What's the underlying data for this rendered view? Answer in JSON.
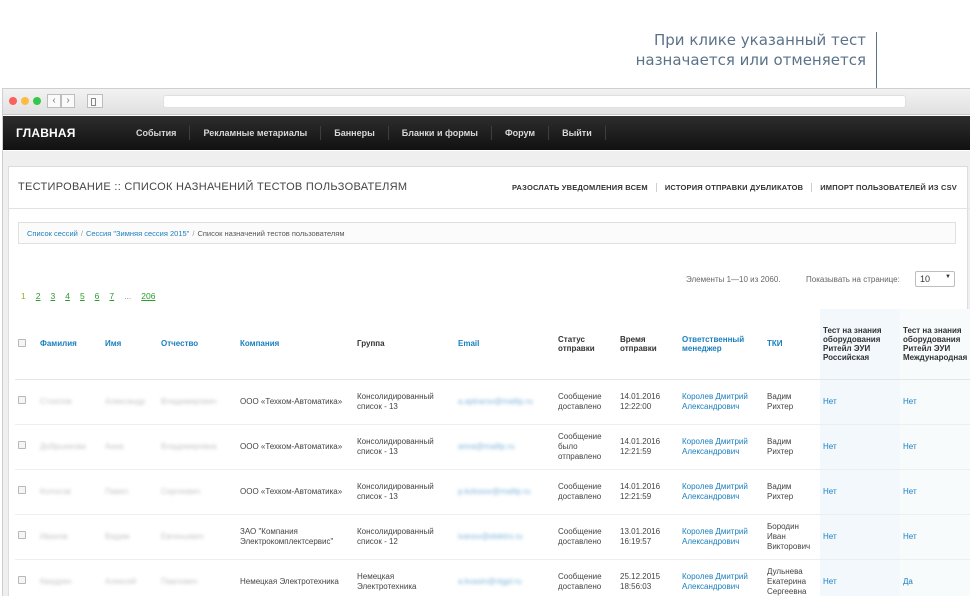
{
  "callout": {
    "line1": "При клике указанный тест",
    "line2": "назначается или отменяется"
  },
  "nav": {
    "brand": "ГЛАВНАЯ",
    "items": [
      "События",
      "Рекламные метариалы",
      "Баннеры",
      "Бланки и формы",
      "Форум",
      "Выйти"
    ]
  },
  "page": {
    "title": "ТЕСТИРОВАНИЕ :: СПИСОК НАЗНАЧЕНИЙ ТЕСТОВ ПОЛЬЗОВАТЕЛЯМ",
    "actions": [
      "РАЗОСЛАТЬ УВЕДОМЛЕНИЯ ВСЕМ",
      "ИСТОРИЯ ОТПРАВКИ ДУБЛИКАТОВ",
      "ИМПОРТ ПОЛЬЗОВАТЕЛЕЙ ИЗ CSV"
    ]
  },
  "breadcrumb": {
    "items": [
      "Список сессий",
      "Сессия \"Зимняя сессия 2015\"",
      "Список назначений тестов пользователям"
    ]
  },
  "pagination": {
    "info": "Элементы 1—10 из 2060.",
    "per_page_label": "Показывать на странице:",
    "per_page_value": "10",
    "pages": [
      "1",
      "2",
      "3",
      "4",
      "5",
      "6",
      "7",
      "...",
      "206"
    ]
  },
  "table": {
    "headers": {
      "lastname": "Фамилия",
      "firstname": "Имя",
      "patronymic": "Отчество",
      "company": "Компания",
      "group": "Группа",
      "email": "Email",
      "status": "Статус отправки",
      "time": "Время отправки",
      "manager": "Ответственный менеджер",
      "tki": "ТКИ",
      "test1": "Тест на знания оборудования Ритейл ЭУИ Российская",
      "test2": "Тест на знания оборудования Ритейл ЭУИ Международная"
    },
    "rows": [
      {
        "lastname": "Стоялов",
        "firstname": "Александр",
        "patronymic": "Владимирович",
        "company": "ООО «Техком-Автоматика»",
        "group": "Консолидированный список - 13",
        "email": "a.aptrarov@mailtp.ru",
        "status": "Сообщение доставлено",
        "time": "14.01.2016 12:22:00",
        "manager": "Королев Дмитрий Александрович",
        "tki": "Вадим Рихтер",
        "test1": "Нет",
        "test2": "Нет"
      },
      {
        "lastname": "Добрынкова",
        "firstname": "Анна",
        "patronymic": "Владимировна",
        "company": "ООО «Техком-Автоматика»",
        "group": "Консолидированный список - 13",
        "email": "anna@mailtp.ru",
        "status": "Сообщение было отправлено",
        "time": "14.01.2016 12:21:59",
        "manager": "Королев Дмитрий Александрович",
        "tki": "Вадим Рихтер",
        "test1": "Нет",
        "test2": "Нет"
      },
      {
        "lastname": "Колосов",
        "firstname": "Павел",
        "patronymic": "Сергеевич",
        "company": "ООО «Техком-Автоматика»",
        "group": "Консолидированный список - 13",
        "email": "p.kolosov@mailtp.ru",
        "status": "Сообщение доставлено",
        "time": "14.01.2016 12:21:59",
        "manager": "Королев Дмитрий Александрович",
        "tki": "Вадим Рихтер",
        "test1": "Нет",
        "test2": "Нет"
      },
      {
        "lastname": "Иванов",
        "firstname": "Вадим",
        "patronymic": "Евгеньевич",
        "company": "ЗАО \"Компания Электрокомплектсервис\"",
        "group": "Консолидированный список - 12",
        "email": "ivanov@elektro.ru",
        "status": "Сообщение доставлено",
        "time": "13.01.2016 16:19:57",
        "manager": "Королев Дмитрий Александрович",
        "tki": "Бородин Иван Викторович",
        "test1": "Нет",
        "test2": "Нет"
      },
      {
        "lastname": "Квадрин",
        "firstname": "Алексей",
        "patronymic": "Павлович",
        "company": "Немецкая Электротехника",
        "group": "Немецкая Электротехника",
        "email": "a.kvasin@nlgpl.ru",
        "status": "Сообщение доставлено",
        "time": "25.12.2015 18:56:03",
        "manager": "Королев Дмитрий Александрович",
        "tki": "Дульнева Екатерина Сергеевна",
        "test1": "Нет",
        "test2": "Да"
      }
    ]
  }
}
